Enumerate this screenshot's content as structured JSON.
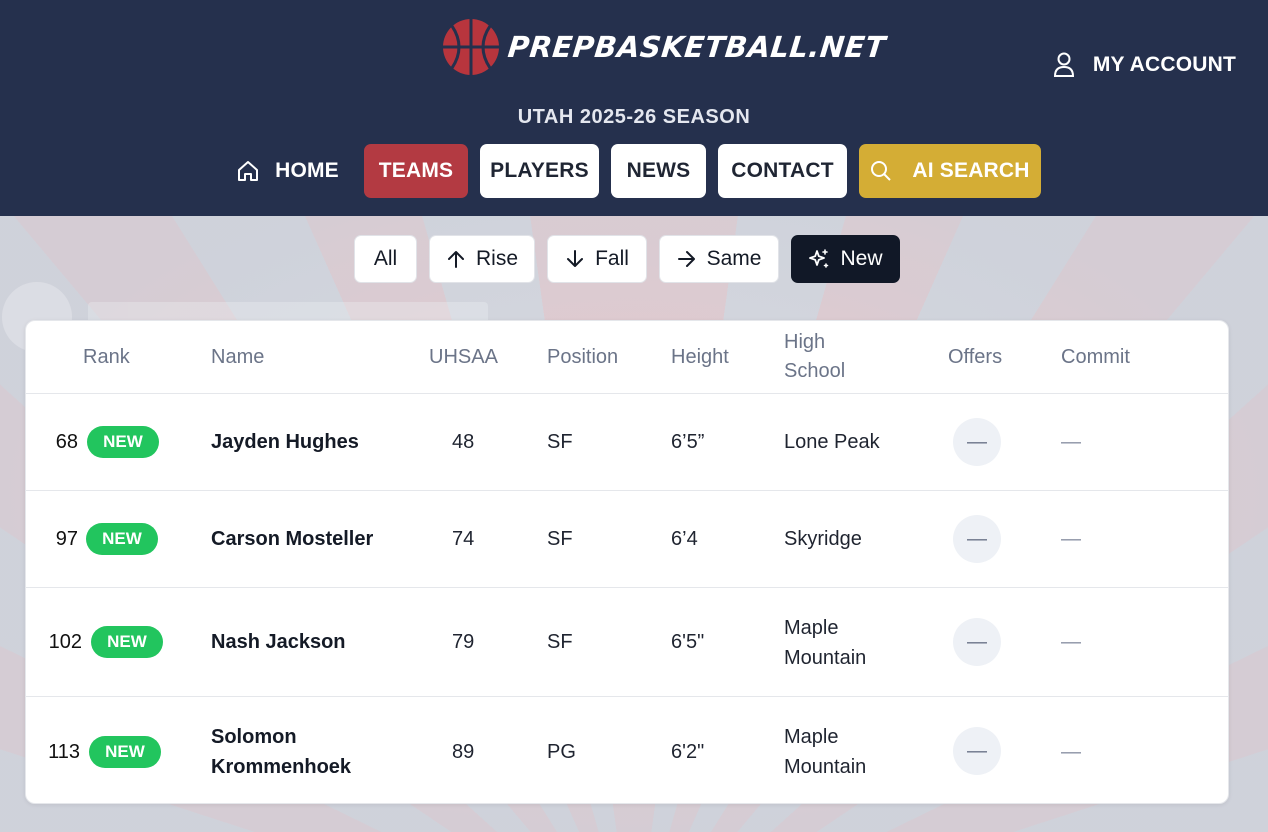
{
  "header": {
    "logo_text": "PREPBASKETBALL.NET",
    "account_label": "MY ACCOUNT",
    "season": "UTAH 2025-26 SEASON",
    "bg_color": "#25304d"
  },
  "nav": {
    "home": "HOME",
    "teams": "TEAMS",
    "players": "PLAYERS",
    "news": "NEWS",
    "contact": "CONTACT",
    "ai_search": "AI SEARCH",
    "active": "TEAMS",
    "teams_color": "#b33a42",
    "ai_color": "#d4ad35"
  },
  "filters": {
    "all": "All",
    "rise": "Rise",
    "fall": "Fall",
    "same": "Same",
    "new": "New",
    "selected": "New"
  },
  "table": {
    "headers": {
      "rank": "Rank",
      "name": "Name",
      "uhsaa": "UHSAA",
      "position": "Position",
      "height": "Height",
      "school_line1": "High",
      "school_line2": "School",
      "offers": "Offers",
      "commit": "Commit"
    },
    "badge_color": "#22c55e",
    "rows": [
      {
        "rank": "68",
        "badge": "NEW",
        "name_line1": "Jayden Hughes",
        "name_line2": "",
        "uhsaa": "48",
        "position": "SF",
        "height": "6’5”",
        "school_line1": "Lone Peak",
        "school_line2": "",
        "offers": "—",
        "commit": "—"
      },
      {
        "rank": "97",
        "badge": "NEW",
        "name_line1": "Carson Mosteller",
        "name_line2": "",
        "uhsaa": "74",
        "position": "SF",
        "height": "6’4",
        "school_line1": "Skyridge",
        "school_line2": "",
        "offers": "—",
        "commit": "—"
      },
      {
        "rank": "102",
        "badge": "NEW",
        "name_line1": "Nash Jackson",
        "name_line2": "",
        "uhsaa": "79",
        "position": "SF",
        "height": "6'5\"",
        "school_line1": "Maple",
        "school_line2": "Mountain",
        "offers": "—",
        "commit": "—"
      },
      {
        "rank": "113",
        "badge": "NEW",
        "name_line1": "Solomon",
        "name_line2": "Krommenhoek",
        "uhsaa": "89",
        "position": "PG",
        "height": "6'2\"",
        "school_line1": "Maple",
        "school_line2": "Mountain",
        "offers": "—",
        "commit": "—"
      }
    ]
  }
}
